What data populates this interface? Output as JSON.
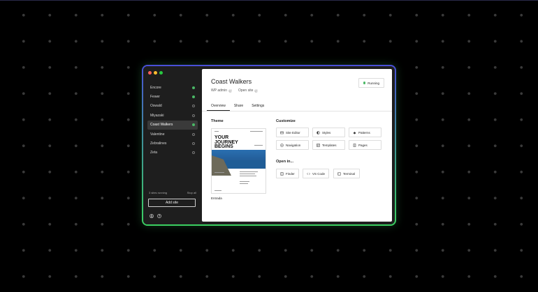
{
  "sidebar": {
    "sites": [
      {
        "name": "Encore",
        "running": true
      },
      {
        "name": "Fewer",
        "running": true
      },
      {
        "name": "Oswald",
        "running": false
      },
      {
        "name": "Miyazaki",
        "running": false
      },
      {
        "name": "Coast Walkers",
        "running": true,
        "selected": true
      },
      {
        "name": "Valentine",
        "running": false
      },
      {
        "name": "Zebralines",
        "running": false
      },
      {
        "name": "Zeta",
        "running": false
      }
    ],
    "running_text": "3 sites running",
    "stop_all": "Stop all",
    "add_site": "Add site"
  },
  "main": {
    "title": "Coast Walkers",
    "wp_admin": "WP admin",
    "open_site": "Open site",
    "status": "Running",
    "tabs": [
      "Overview",
      "Share",
      "Settings"
    ],
    "theme_heading": "Theme",
    "theme_preview_headline": "YOUR JOURNEY BEGINS",
    "theme_name": "Entrada",
    "customize_heading": "Customize",
    "customize": [
      "Site Editor",
      "Styles",
      "Patterns",
      "Navigation",
      "Templates",
      "Pages"
    ],
    "open_in_heading": "Open in...",
    "open_in": [
      "Finder",
      "VS Code",
      "Terminal"
    ]
  },
  "colors": {
    "accent_frame_top": "#4a4fd8",
    "accent_frame_bottom": "#3bd061",
    "running": "#4ab866"
  }
}
